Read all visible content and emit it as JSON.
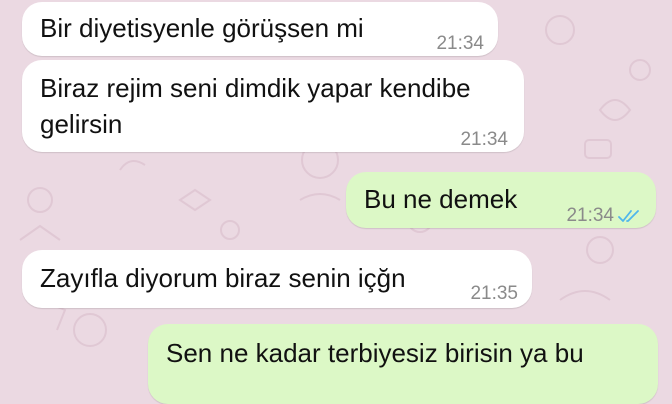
{
  "chat": {
    "messages": [
      {
        "direction": "incoming",
        "text": "Bir diyetisyenle görüşsen mi",
        "time": "21:34"
      },
      {
        "direction": "incoming",
        "line1": "Biraz rejim seni dimdik yapar kendibe",
        "line2": "gelirsin",
        "time": "21:34"
      },
      {
        "direction": "outgoing",
        "text": "Bu ne demek",
        "time": "21:34",
        "status": "read"
      },
      {
        "direction": "incoming",
        "text": "Zayıfla diyorum biraz senin içğn",
        "time": "21:35"
      },
      {
        "direction": "outgoing",
        "text": "Sen ne kadar terbiyesiz birisin ya bu"
      }
    ]
  },
  "colors": {
    "wallpaper": "#ebd9e2",
    "incoming_bubble": "#ffffff",
    "outgoing_bubble": "#dcf8c6",
    "read_ticks": "#4fb6ec",
    "time_text": "#8a8a8a"
  },
  "icons": {
    "read_status": "double-check-icon"
  }
}
